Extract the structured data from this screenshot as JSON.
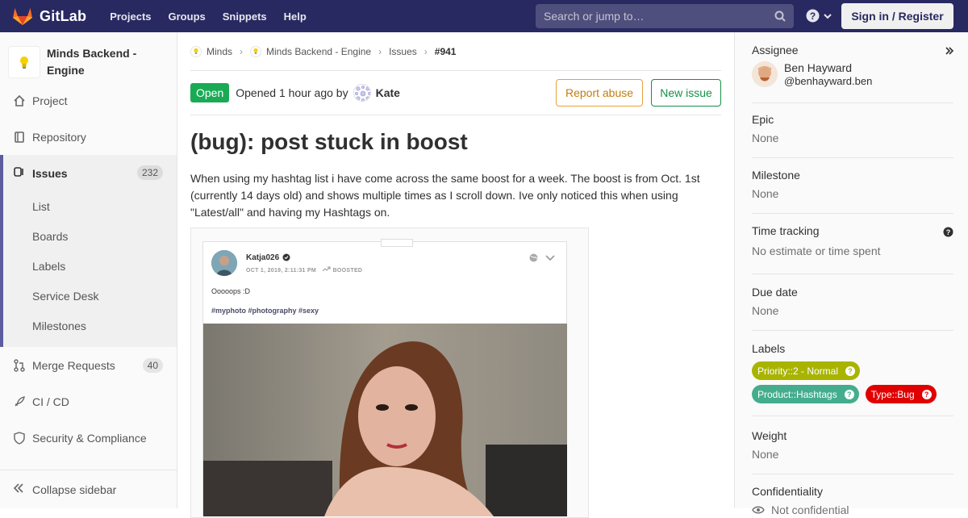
{
  "app": {
    "name": "GitLab"
  },
  "topnav": {
    "links": [
      "Projects",
      "Groups",
      "Snippets",
      "Help"
    ],
    "search_placeholder": "Search or jump to…",
    "signin_label": "Sign in / Register"
  },
  "sidebar": {
    "project_name": "Minds Backend - Engine",
    "items": {
      "project": "Project",
      "repository": "Repository",
      "issues": "Issues",
      "issues_count": "232",
      "merge_requests": "Merge Requests",
      "merge_requests_count": "40",
      "cicd": "CI / CD",
      "security": "Security & Compliance"
    },
    "issues_sub": [
      "List",
      "Boards",
      "Labels",
      "Service Desk",
      "Milestones"
    ],
    "collapse_label": "Collapse sidebar"
  },
  "breadcrumb": [
    "Minds",
    "Minds Backend - Engine",
    "Issues",
    "#941"
  ],
  "issue": {
    "status": "Open",
    "opened_text": "Opened 1 hour ago by",
    "author": "Kate",
    "report_label": "Report abuse",
    "new_issue_label": "New issue",
    "title": "(bug): post stuck in boost",
    "description": "When using my hashtag list i have come across the same boost for a week. The boost is from Oct. 1st (currently 14 days old) and shows multiple times as I scroll down. Ive only noticed this when using \"Latest/all\" and having my Hashtags on."
  },
  "embedded_post": {
    "username": "Katja026",
    "meta": "OCT 1, 2019, 2:11:31 PM",
    "boosted": "BOOSTED",
    "text": "Ooooops :D",
    "tags": "#myphoto #photography #sexy"
  },
  "right_sidebar": {
    "assignee_title": "Assignee",
    "assignee_name": "Ben Hayward",
    "assignee_handle": "@benhayward.ben",
    "epic_title": "Epic",
    "epic_value": "None",
    "milestone_title": "Milestone",
    "milestone_value": "None",
    "time_title": "Time tracking",
    "time_value": "No estimate or time spent",
    "due_title": "Due date",
    "due_value": "None",
    "labels_title": "Labels",
    "labels": [
      {
        "text": "Priority::2 - Normal",
        "color": "#a8b400"
      },
      {
        "text": "Product::Hashtags",
        "color": "#44ad8e"
      },
      {
        "text": "Type::Bug",
        "color": "#e00000"
      }
    ],
    "weight_title": "Weight",
    "weight_value": "None",
    "confidentiality_title": "Confidentiality",
    "confidentiality_value": "Not confidential"
  },
  "colors": {
    "navbar": "#292961",
    "accent": "#5c5c9e",
    "status_open": "#1aaa55"
  }
}
